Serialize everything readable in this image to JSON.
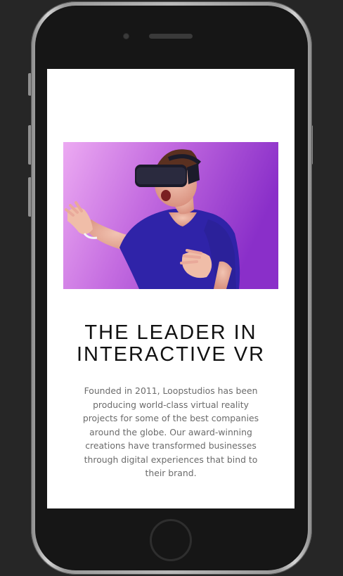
{
  "hero": {
    "title_line1": "THE LEADER IN",
    "title_line2": "INTERACTIVE VR",
    "description": "Founded in 2011, Loopstudios has been producing world-class virtual reality projects for some of the best companies around the globe. Our award-winning creations have transformed businesses through digital experiences that bind to their brand.",
    "image_icon": "vr-headset-person-photo"
  },
  "colors": {
    "page_background": "#262626",
    "screen_background": "#ffffff",
    "title": "#111111",
    "body_text": "#6b6b6b",
    "photo_gradient_start": "#e9a0f0",
    "photo_gradient_end": "#8a2fc9"
  }
}
